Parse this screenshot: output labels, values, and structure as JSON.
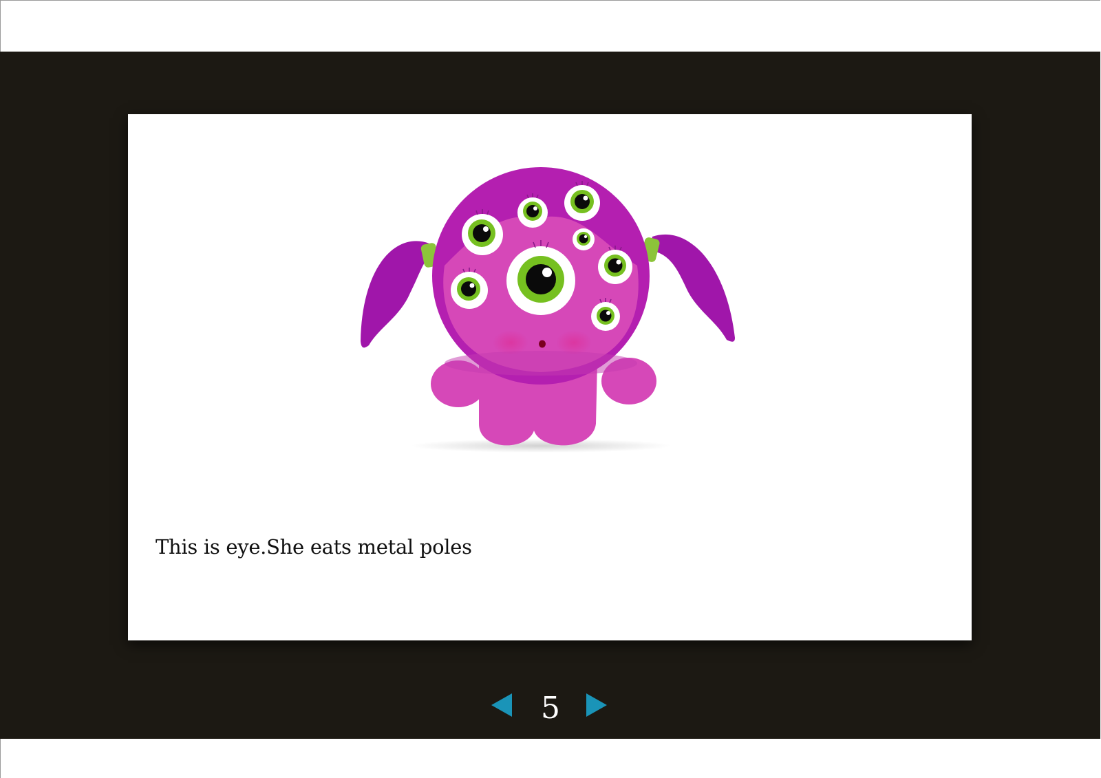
{
  "slide": {
    "caption": "This is eye.She eats metal poles",
    "illustration_icon": "pink-monster-icon"
  },
  "navigation": {
    "page_number": "5",
    "prev_icon": "left-arrow-icon",
    "next_icon": "right-arrow-icon",
    "arrow_color": "#1a94b8"
  },
  "colors": {
    "viewer_background": "#1c1913",
    "monster_hair": "#a016aa",
    "monster_body": "#d648b8",
    "eye_iris": "#76c020"
  }
}
